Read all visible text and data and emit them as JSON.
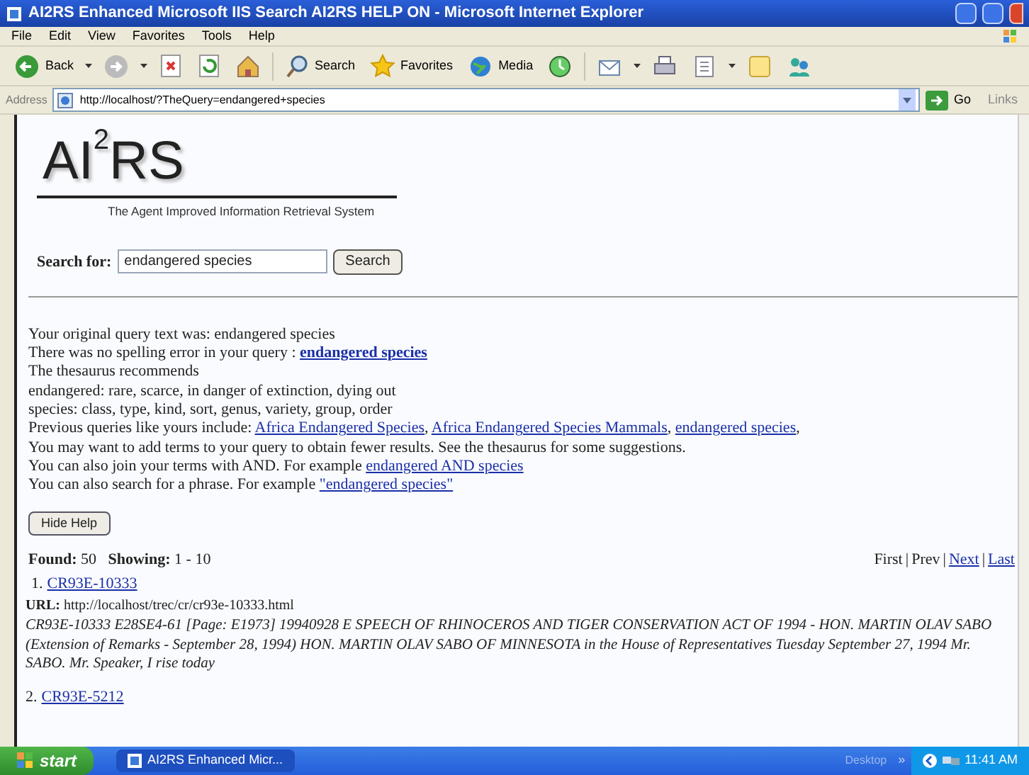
{
  "window": {
    "title": "AI2RS Enhanced Microsoft IIS Search AI2RS HELP ON - Microsoft Internet Explorer"
  },
  "menu": [
    "File",
    "Edit",
    "View",
    "Favorites",
    "Tools",
    "Help"
  ],
  "toolbar": [
    {
      "kind": "back",
      "label": "Back"
    },
    {
      "kind": "forward"
    },
    {
      "kind": "stop"
    },
    {
      "kind": "refresh"
    },
    {
      "kind": "home"
    },
    {
      "kind": "search",
      "label": "Search"
    },
    {
      "kind": "favorites",
      "label": "Favorites"
    },
    {
      "kind": "media",
      "label": "Media"
    },
    {
      "kind": "history"
    },
    {
      "kind": "mail"
    },
    {
      "kind": "print"
    },
    {
      "kind": "edit"
    },
    {
      "kind": "discuss"
    },
    {
      "kind": "messenger"
    }
  ],
  "address": {
    "label": "Address",
    "value": "http://localhost/?TheQuery=endangered+species",
    "go": "Go",
    "links": "Links"
  },
  "logo": {
    "base": "AI",
    "sup": "2",
    "rest": "RS",
    "tagline": "The Agent Improved Information Retrieval System"
  },
  "search": {
    "label": "Search for:",
    "value": "endangered species",
    "button": "Search"
  },
  "help_lines": [
    {
      "parts": [
        {
          "kind": "text",
          "text": "Your original query text was: endangered species"
        }
      ]
    },
    {
      "parts": [
        {
          "kind": "text",
          "text": "There was no spelling error in your query : "
        },
        {
          "kind": "strong_link",
          "text": "endangered species"
        }
      ]
    },
    {
      "parts": [
        {
          "kind": "text",
          "text": "The thesaurus recommends"
        }
      ]
    },
    {
      "parts": [
        {
          "kind": "text",
          "text": "endangered: rare, scarce, in danger of extinction, dying out"
        }
      ]
    },
    {
      "parts": [
        {
          "kind": "text",
          "text": "species: class, type, kind, sort, genus, variety, group, order"
        }
      ]
    },
    {
      "parts": [
        {
          "kind": "text",
          "text": "Previous queries like yours include: "
        },
        {
          "kind": "link",
          "text": "Africa Endangered Species"
        },
        {
          "kind": "text",
          "text": ", "
        },
        {
          "kind": "link",
          "text": "Africa Endangered Species Mammals"
        },
        {
          "kind": "text",
          "text": ", "
        },
        {
          "kind": "link",
          "text": "endangered species"
        },
        {
          "kind": "text",
          "text": ","
        }
      ]
    },
    {
      "parts": [
        {
          "kind": "text",
          "text": "You may want to add terms to your query to obtain fewer results. See the thesaurus for some suggestions."
        }
      ]
    },
    {
      "parts": [
        {
          "kind": "text",
          "text": "You can also join your terms with AND. For example "
        },
        {
          "kind": "link",
          "text": "endangered AND species"
        }
      ]
    },
    {
      "parts": [
        {
          "kind": "text",
          "text": "You can also search for a phrase. For example "
        },
        {
          "kind": "link",
          "text": "\"endangered species\""
        }
      ]
    }
  ],
  "hide_help": "Hide Help",
  "summary": {
    "found_label": "Found:",
    "found": "50",
    "showing_label": "Showing:",
    "showing": "1 - 10"
  },
  "pager": [
    {
      "text": "First",
      "link": false
    },
    {
      "separator": "|",
      "text": "Prev",
      "link": false
    },
    {
      "separator": "|",
      "text": "Next",
      "link": true
    },
    {
      "separator": "|",
      "text": "Last",
      "link": true
    }
  ],
  "results": [
    {
      "number": "1.",
      "id": "CR93E-10333",
      "url_label": "URL:",
      "url": "http://localhost/trec/cr/cr93e-10333.html",
      "abstract": "CR93E-10333 E28SE4-61 [Page: E1973] 19940928 E SPEECH OF RHINOCEROS AND TIGER CONSERVATION ACT OF 1994 - HON. MARTIN OLAV SABO (Extension of Remarks - September 28, 1994) HON. MARTIN OLAV SABO OF MINNESOTA in the House of Representatives Tuesday September 27, 1994 Mr. SABO. Mr. Speaker, I rise today"
    },
    {
      "number": "2.",
      "id": "CR93E-5212"
    }
  ],
  "taskbar": {
    "start": "start",
    "task": "AI2RS Enhanced Micr...",
    "desktop": "Desktop",
    "chevron": "»",
    "clock": "11:41 AM"
  }
}
